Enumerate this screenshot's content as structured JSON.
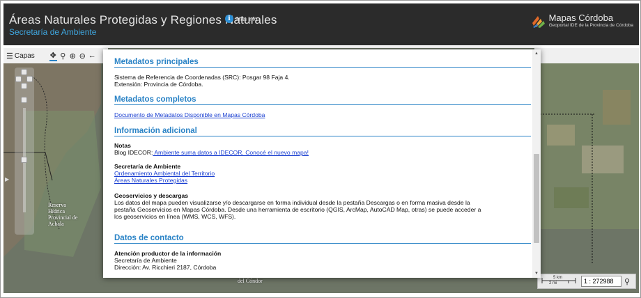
{
  "header": {
    "title": "Áreas Naturales Protegidas y Regiones Naturales",
    "subtitle": "Secretaría de Ambiente",
    "info_label": "Más info",
    "brand_title": "Mapas Córdoba",
    "brand_subtitle": "Geoportal IDE de la Provincia de Córdoba"
  },
  "toolbar": {
    "layers_label": "Capas",
    "tools": [
      "pan-icon",
      "zoom-icon",
      "zoom-in-icon",
      "zoom-out-icon",
      "back-icon"
    ]
  },
  "map": {
    "reserve_label_lines": [
      "Reserva",
      "Hídrica",
      "Provincial de",
      "Achala"
    ],
    "condor_label": "del Cóndor",
    "scale_km": "5 km",
    "scale_mi": "2 mi",
    "scale_value": "1 : 272988"
  },
  "modal": {
    "s1_title": "Metadatos principales",
    "s1_line1": "Sistema de Referencia de Coordenadas (SRC): Posgar 98 Faja 4.",
    "s1_line2": "Extensión: Provincia de Córdoba.",
    "s2_title": "Metadatos completos",
    "s2_link": "Documento de Metadatos Disponible en Mapas Córdoba",
    "s3_title": "Información adicional",
    "notes_label": "Notas",
    "blog_prefix": "Blog IDECOR:",
    "blog_link": " Ambiente suma datos a IDECOR. Conocé el nuevo mapa!",
    "secretaria_label": "Secretaría de Ambiente",
    "link_ordenamiento": "Ordenamiento Ambiental del Territorio",
    "link_areas": "Áreas Naturales Protegidas ",
    "geo_label": "Geoservicios y descargas",
    "geo_line1": "Los datos del mapa pueden visualizarse y/o descargarse en forma individual desde la  pestaña Descargas o en forma masiva desde la",
    "geo_line2": "pestaña Geoservicios en Mapas Córdoba. Desde una herramienta de escritorio (QGIS, ArcMap, AutoCAD Map, otras) se puede acceder a",
    "geo_line3": "los geoservicios en línea (WMS, WCS, WFS).",
    "s4_title": "Datos de contacto",
    "contact_label": "Atención productor de la información",
    "contact_org": "Secretaría de Ambiente",
    "contact_address": "Dirección: Av. Ricchieri 2187, Córdoba"
  }
}
